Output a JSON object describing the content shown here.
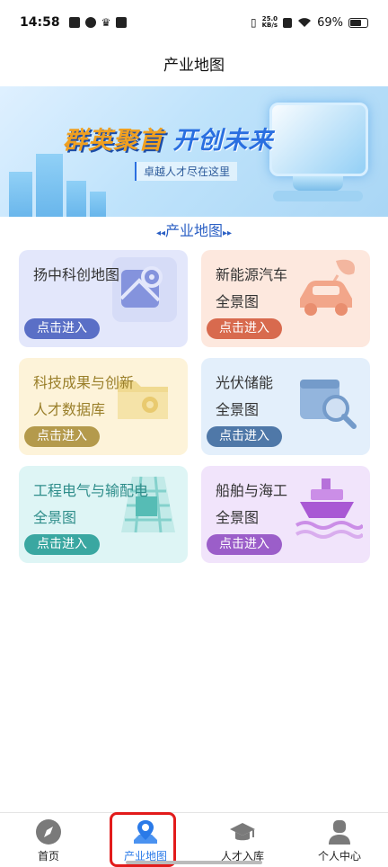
{
  "status_bar": {
    "time": "14:58",
    "net_speed_value": "25.0",
    "net_speed_unit": "KB/s",
    "battery_percent": "69%"
  },
  "header": {
    "title": "产业地图"
  },
  "banner": {
    "headline_part1": "群英聚首",
    "headline_part2": "开创未来",
    "subtitle": "卓越人才尽在这里"
  },
  "section": {
    "title": "产业地图",
    "left_arrow": "◂◂",
    "right_arrow": "▸▸"
  },
  "cards": [
    {
      "line1": "扬中科创地图",
      "line2": "",
      "button": "点击进入",
      "icon": "map-pin-icon",
      "accent": "#5a6fc6"
    },
    {
      "line1": "新能源汽车",
      "line2": "全景图",
      "button": "点击进入",
      "icon": "car-icon",
      "accent": "#d86a4e"
    },
    {
      "line1": "科技成果与创新",
      "line2": "人才数据库",
      "button": "点击进入",
      "icon": "database-folder-icon",
      "accent": "#b49a4c"
    },
    {
      "line1": "光伏储能",
      "line2": "全景图",
      "button": "点击进入",
      "icon": "box-search-icon",
      "accent": "#4f78a8"
    },
    {
      "line1": "工程电气与输配电",
      "line2": "全景图",
      "button": "点击进入",
      "icon": "grid-tower-icon",
      "accent": "#3aa7a1"
    },
    {
      "line1": "船舶与海工",
      "line2": "全景图",
      "button": "点击进入",
      "icon": "ship-icon",
      "accent": "#9b5ec9"
    }
  ],
  "bottom_nav": [
    {
      "label": "首页",
      "icon": "compass-icon"
    },
    {
      "label": "产业地图",
      "icon": "map-location-icon",
      "active": true
    },
    {
      "label": "人才入库",
      "icon": "graduation-cap-icon"
    },
    {
      "label": "个人中心",
      "icon": "person-icon"
    }
  ]
}
